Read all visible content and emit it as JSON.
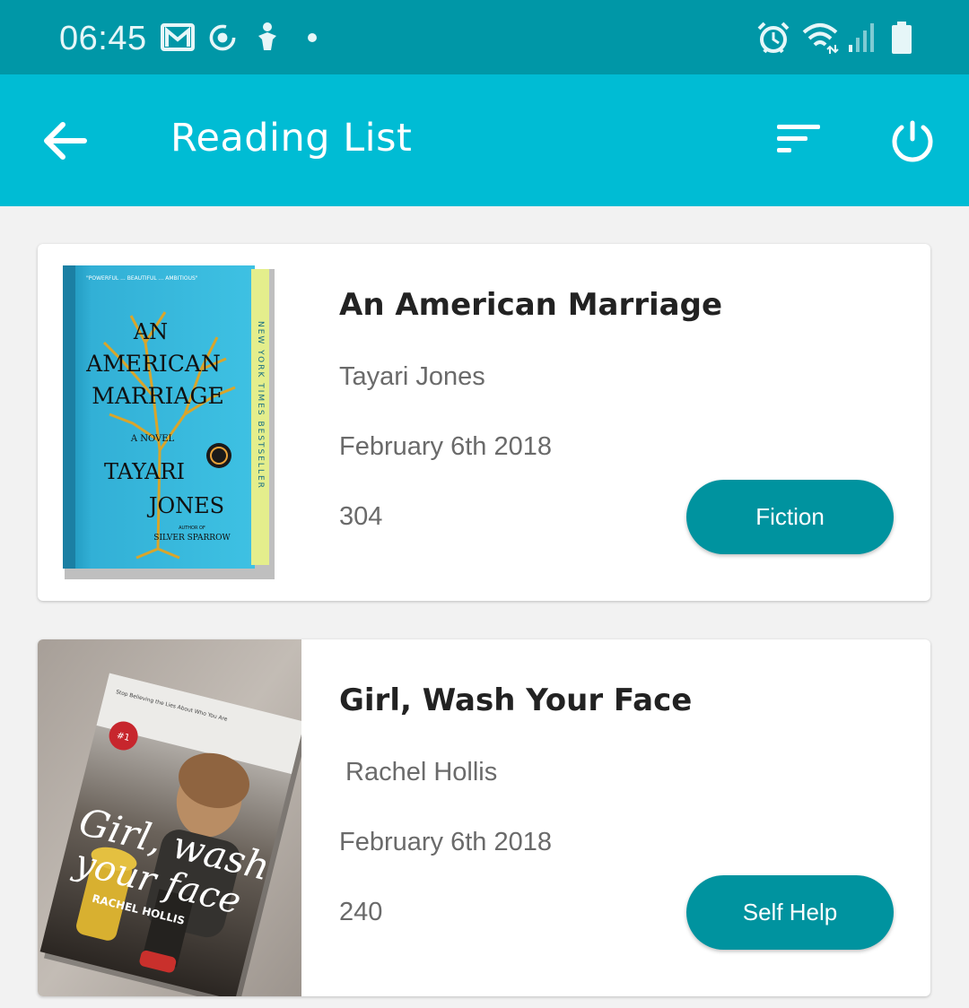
{
  "status_bar": {
    "time": "06:45",
    "left_icons": [
      "gmail-icon",
      "sync-icon",
      "accessibility-icon",
      "dot-icon"
    ],
    "right_icons": [
      "alarm-icon",
      "wifi-icon",
      "signal-icon",
      "battery-icon"
    ]
  },
  "app_bar": {
    "title": "Reading List",
    "back_icon": "arrow-left-icon",
    "sort_icon": "sort-icon",
    "power_icon": "power-icon"
  },
  "books": [
    {
      "title": "An American Marriage",
      "author": "Tayari Jones",
      "date": "February 6th 2018",
      "pages": "304",
      "genre": "Fiction",
      "cover": {
        "top_line": "\"POWERFUL ... BEAUTIFUL ... AMBITIOUS\"",
        "line1": "AN",
        "line2": "AMERICAN",
        "line3": "MARRIAGE",
        "subtitle": "A NOVEL",
        "author_first": "TAYARI",
        "author_last": "JONES",
        "byline_small": "AUTHOR OF",
        "previous_book": "SILVER SPARROW",
        "side_text": "NEW YORK TIMES BESTSELLER"
      }
    },
    {
      "title": "Girl, Wash Your Face",
      "author": "Rachel Hollis",
      "date": "February 6th 2018",
      "pages": "240",
      "genre": "Self Help",
      "cover": {
        "tagline": "Stop Believing the Lies About Who You Are",
        "badge": "#1",
        "script_line1": "Girl, wash",
        "script_line2": "your face",
        "author_caps": "RACHEL HOLLIS"
      }
    }
  ],
  "colors": {
    "status_bar": "#0097a7",
    "app_bar": "#00bcd4",
    "genre_button": "#00939f",
    "background": "#f2f2f2"
  }
}
